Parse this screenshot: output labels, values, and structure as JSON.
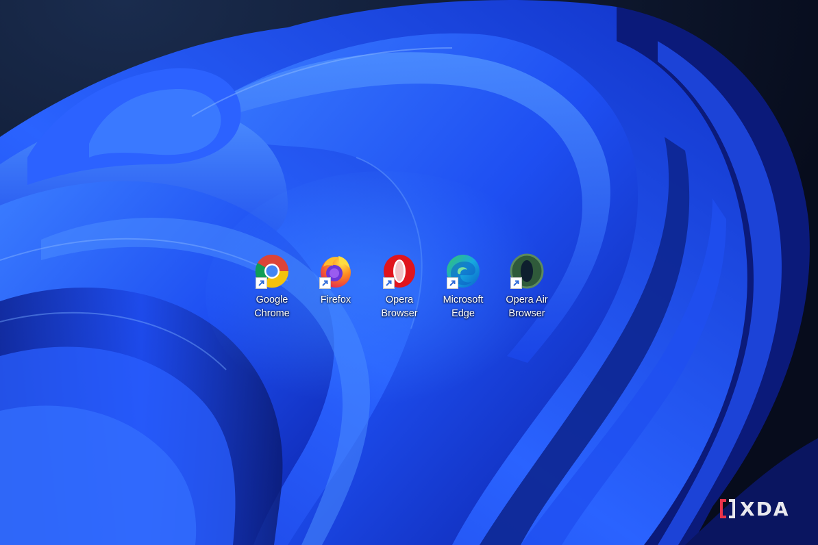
{
  "desktop": {
    "icons": [
      {
        "name": "google-chrome",
        "line1": "Google",
        "line2": "Chrome",
        "icon": "chrome-icon"
      },
      {
        "name": "firefox",
        "line1": "Firefox",
        "line2": "",
        "icon": "firefox-icon"
      },
      {
        "name": "opera-browser",
        "line1": "Opera",
        "line2": "Browser",
        "icon": "opera-icon"
      },
      {
        "name": "microsoft-edge",
        "line1": "Microsoft",
        "line2": "Edge",
        "icon": "edge-icon"
      },
      {
        "name": "opera-air-browser",
        "line1": "Opera Air",
        "line2": "Browser",
        "icon": "opera-air-icon"
      }
    ]
  },
  "watermark": {
    "text": "XDA",
    "accent": "#e8334a"
  },
  "colors": {
    "wallpaper_blue": "#1f55ff",
    "wallpaper_dark": "#0a1530"
  }
}
